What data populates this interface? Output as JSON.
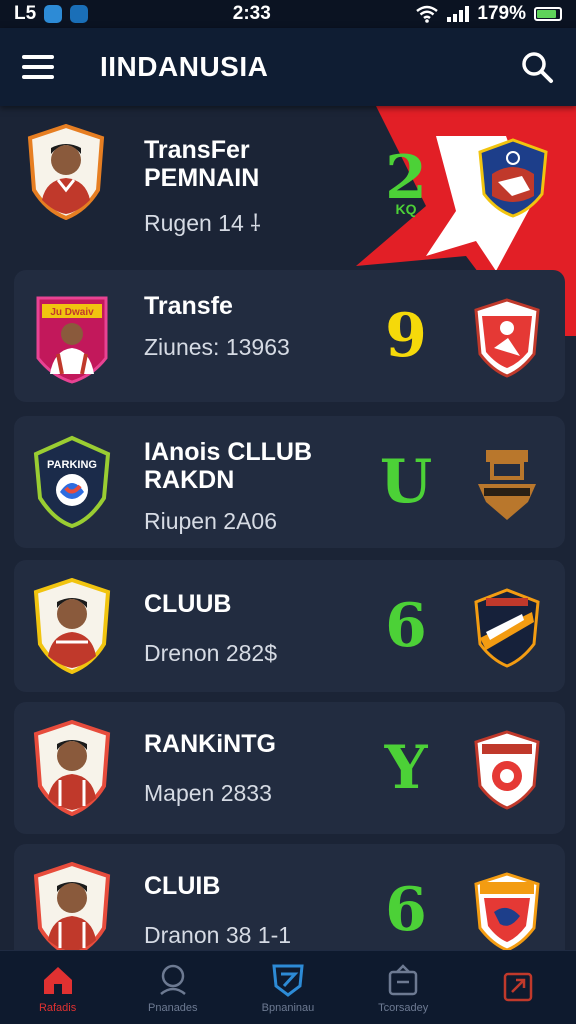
{
  "status_bar": {
    "left_text": "L5",
    "time": "2:33",
    "battery": "179%",
    "battery_level": 0.85
  },
  "app_bar": {
    "title": "IINDANUSIA"
  },
  "cards": [
    {
      "title": "TransFer\nPEMNAIN",
      "meta": "Rugen 14  ⸸",
      "rank": "2",
      "rank_sub": "KQ",
      "rank_color": "#4cd137",
      "jersey_color": "#c0392b",
      "frame_color": "#e67e22"
    },
    {
      "title": "Transfe",
      "meta": "Ziunes: 13963",
      "rank": "9",
      "rank_color": "#f5d90a",
      "jersey_color": "#c0392b",
      "frame_color": "#e84393",
      "frame_label": "Ju Dwaiv"
    },
    {
      "title": "IAnois CLLUB\nRAKDN",
      "meta": "Riupen 2A06",
      "rank": "U",
      "rank_color": "#4cd137",
      "badge_label": "PARKING"
    },
    {
      "title": "CLUUB",
      "meta": "Drenon 282$",
      "rank": "6",
      "rank_color": "#4cd137",
      "jersey_color": "#c0392b",
      "frame_color": "#f1c40f"
    },
    {
      "title": "RANKiNTG",
      "meta": "Mapen 2833",
      "rank": "Y",
      "rank_color": "#4cd137",
      "jersey_color": "#c0392b",
      "frame_color": "#e74c3c"
    },
    {
      "title": "CLUIB",
      "meta": "Dranon 38 1-1",
      "rank": "6",
      "rank_color": "#4cd137",
      "jersey_color": "#c0392b",
      "frame_color": "#e74c3c"
    }
  ],
  "bottom_nav": [
    {
      "label": "Rafadis",
      "icon": "home-icon"
    },
    {
      "label": "Pnanades",
      "icon": "search-icon"
    },
    {
      "label": "Bpnaninau",
      "icon": "club-shield-icon"
    },
    {
      "label": "Tcorsadey",
      "icon": "bag-icon"
    },
    {
      "label": "",
      "icon": "transfer-icon"
    }
  ],
  "colors": {
    "accent_red": "#e03131",
    "card_bg": "#222c40",
    "app_bar": "#0f1d33",
    "rank_green": "#4cd137",
    "rank_yellow": "#f5d90a"
  }
}
